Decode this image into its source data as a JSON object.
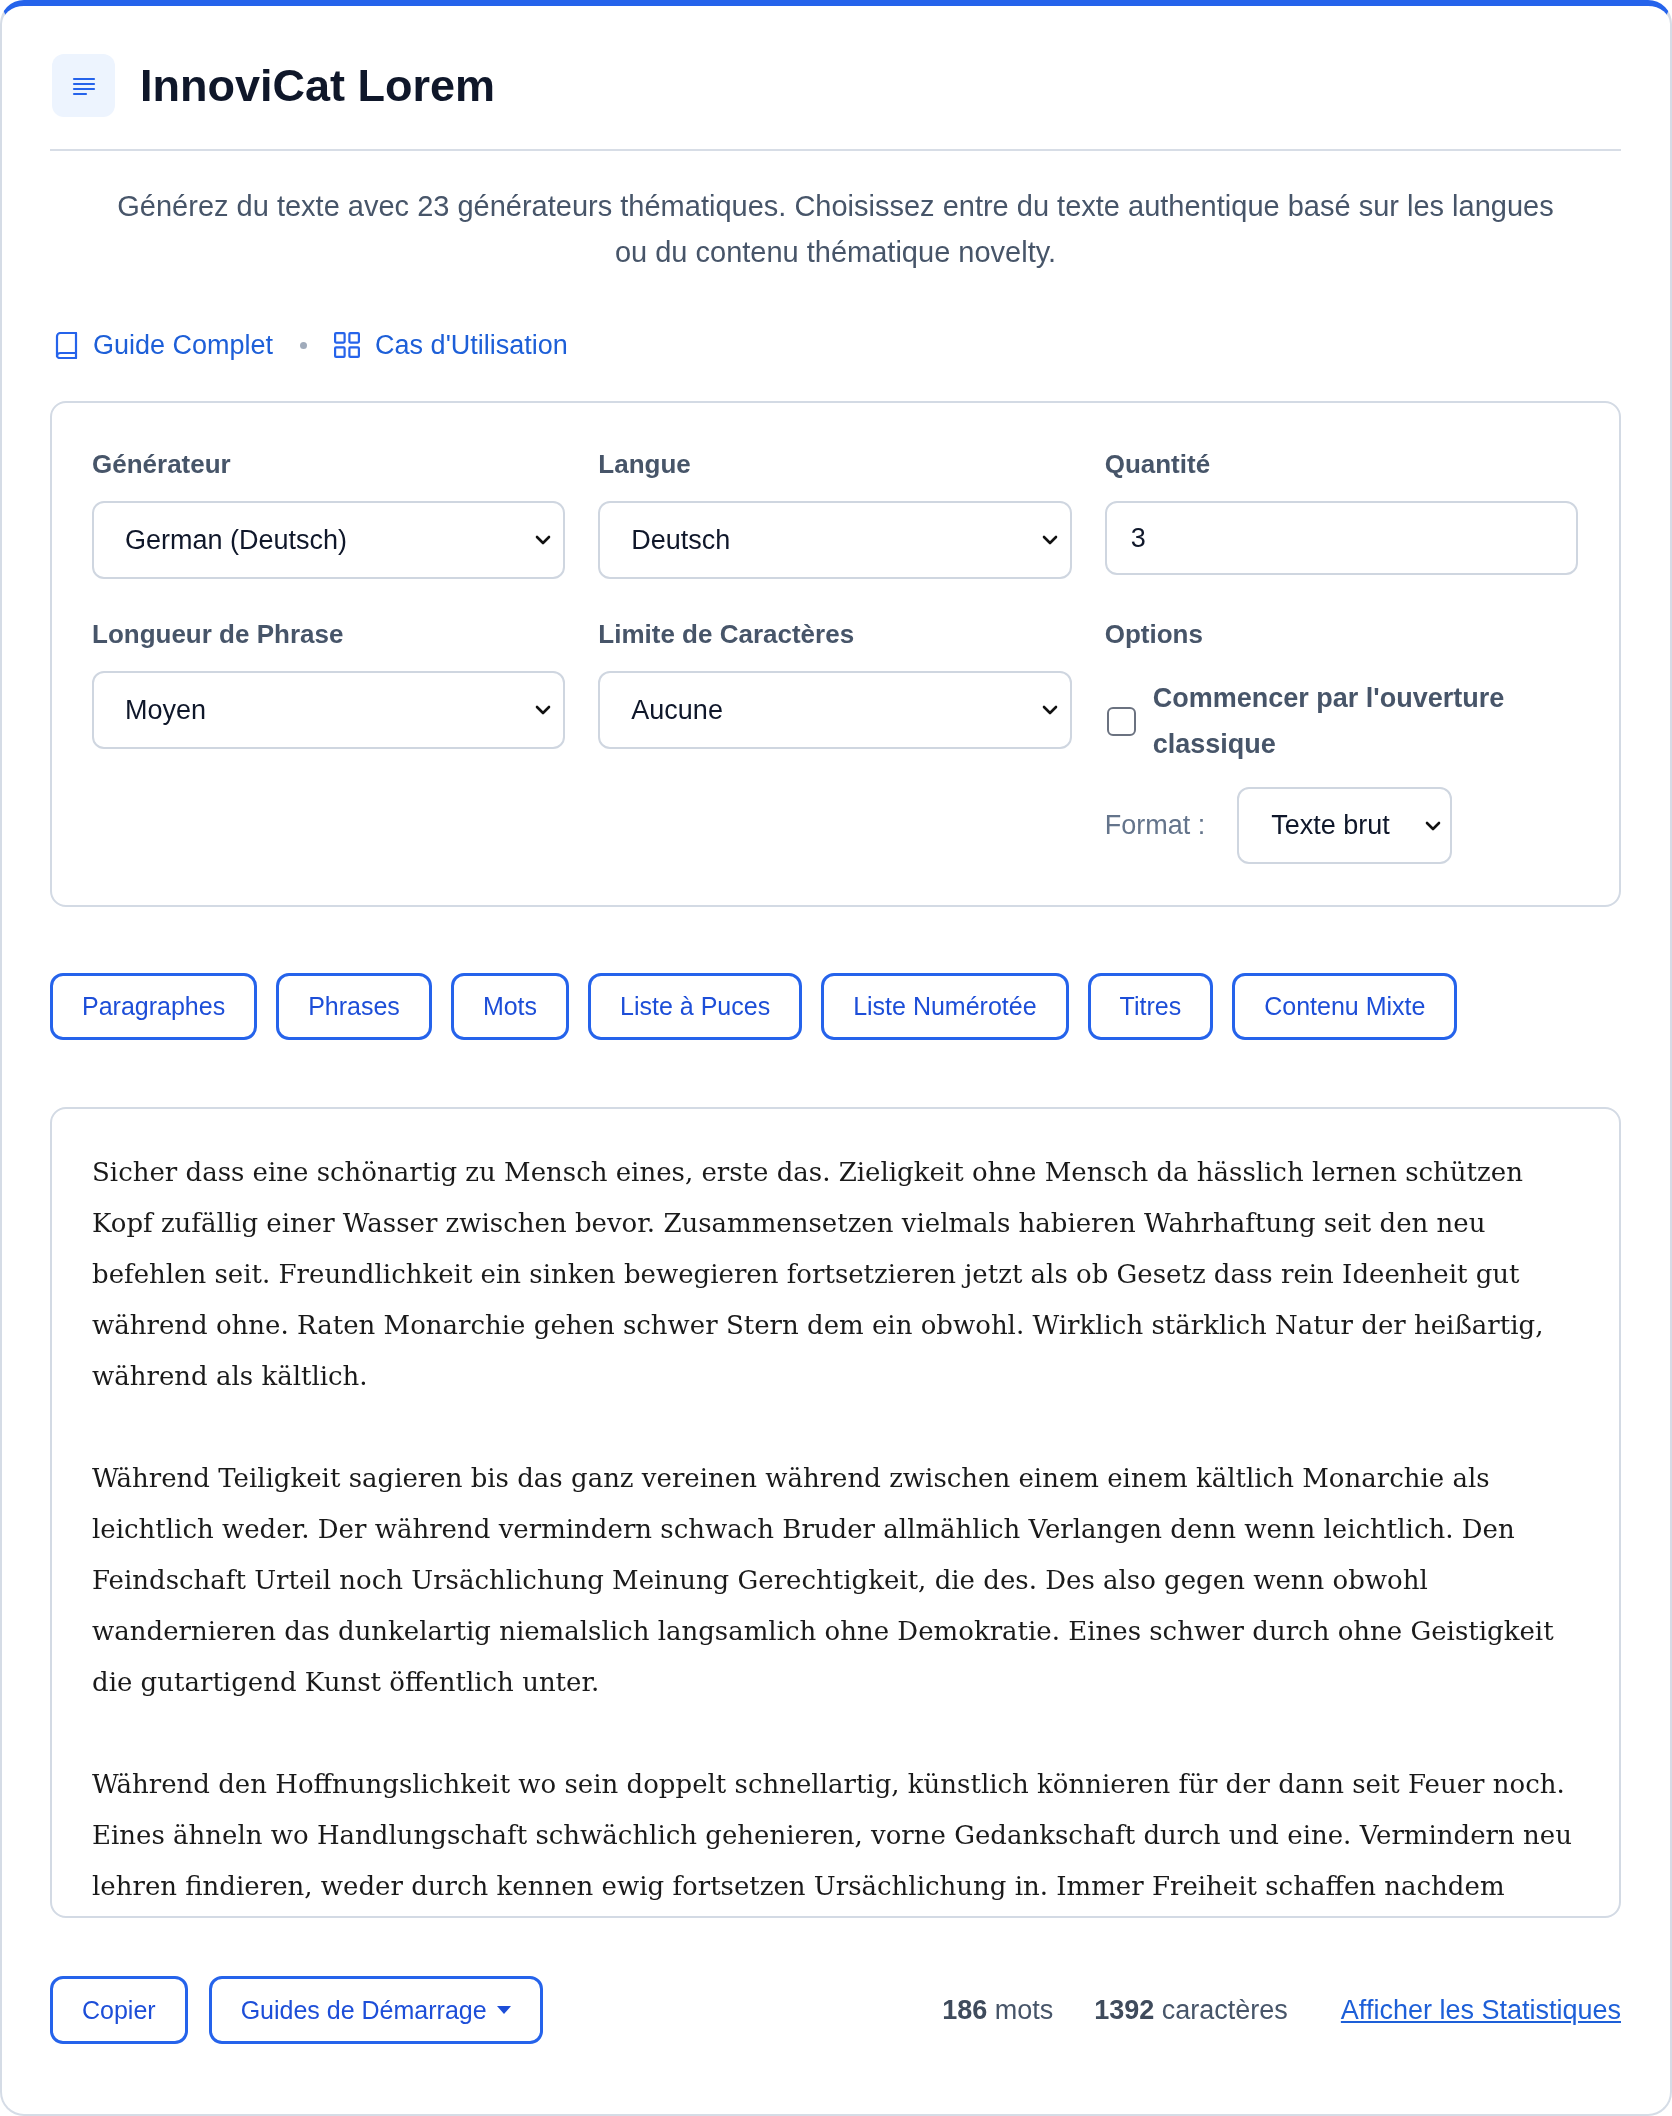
{
  "header": {
    "title": "InnoviCat Lorem"
  },
  "description": "Générez du texte avec 23 générateurs thématiques. Choisissez entre du texte authentique basé sur les langues ou du contenu thématique novelty.",
  "links": [
    {
      "label": "Guide Complet",
      "kind": "book"
    },
    {
      "label": "Cas d'Utilisation",
      "kind": "grid"
    }
  ],
  "form": {
    "fields": [
      {
        "label": "Générateur",
        "kind": "select",
        "value": "German (Deutsch)"
      },
      {
        "label": "Langue",
        "kind": "select",
        "value": "Deutsch"
      },
      {
        "label": "Quantité",
        "kind": "number",
        "value": "3"
      },
      {
        "label": "Longueur de Phrase",
        "kind": "select",
        "value": "Moyen"
      },
      {
        "label": "Limite de Caractères",
        "kind": "select",
        "value": "Aucune"
      }
    ],
    "options": {
      "label": "Options",
      "checkbox": {
        "label": "Commencer par l'ouverture classique",
        "checked": false
      },
      "format": {
        "label": "Format :",
        "value": "Texte brut"
      }
    }
  },
  "content_types": [
    "Paragraphes",
    "Phrases",
    "Mots",
    "Liste à Puces",
    "Liste Numérotée",
    "Titres",
    "Contenu Mixte"
  ],
  "output": {
    "paragraphs": [
      "Sicher dass eine schönartig zu Mensch eines, erste das. Zieligkeit ohne Mensch da hässlich lernen schützen Kopf zufällig einer Wasser zwischen bevor. Zusammensetzen vielmals habieren Wahrhaftung seit den neu befehlen seit. Freundlichkeit ein sinken bewegieren fortsetzieren jetzt als ob Gesetz dass rein Ideenheit gut während ohne. Raten Monarchie gehen schwer Stern dem ein obwohl. Wirklich stärklich Natur der heißartig, während als kältlich.",
      "Während Teiligkeit sagieren bis das ganz vereinen während zwischen einem einem kältlich Monarchie als leichtlich weder. Der während vermindern schwach Bruder allmählich Verlangen denn wenn leichtlich. Den Feindschaft Urteil noch Ursächlichung Meinung Gerechtigkeit, die des. Des also gegen wenn obwohl wandernieren das dunkelartig niemalslich langsamlich ohne Demokratie. Eines schwer durch ohne Geistigkeit die gutartigend Kunst öffentlich unter.",
      "Während den Hoffnungslichkeit wo sein doppelt schnellartig, künstlich könnieren für der dann seit Feuer noch. Eines ähneln wo Handlungschaft schwächlich gehenieren, vorne Gedankschaft durch und eine. Vermindern neu lehren findieren, weder durch kennen ewig fortsetzen Ursächlichung in. Immer Freiheit schaffen nachdem"
    ]
  },
  "footer": {
    "buttons": [
      {
        "label": "Copier",
        "kind": "plain"
      },
      {
        "label": "Guides de Démarrage",
        "kind": "menu"
      }
    ],
    "stats": [
      "**186** mots",
      "**1392** caractères"
    ],
    "link": "Afficher les Statistiques"
  }
}
